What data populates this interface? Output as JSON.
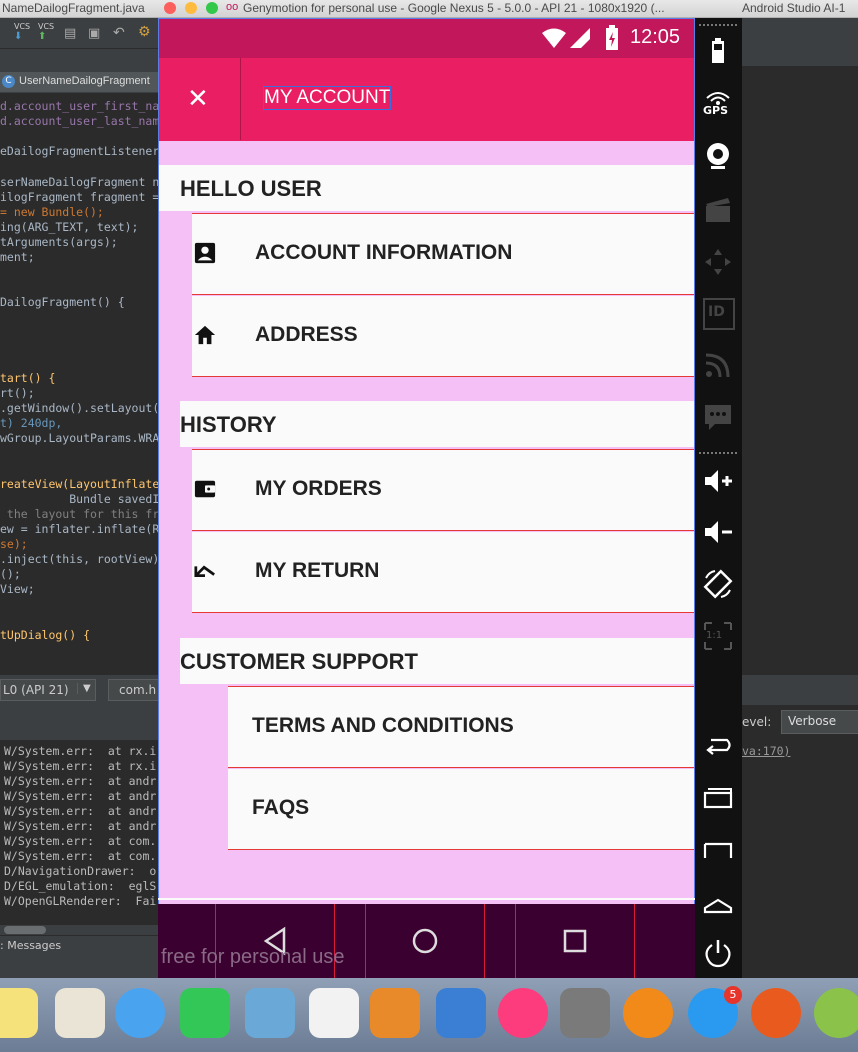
{
  "window": {
    "left_title": "NameDailogFragment.java",
    "title": "Genymotion for personal use - Google Nexus 5 - 5.0.0 - API 21 - 1080x1920 (...",
    "right_title": "Android Studio AI-1",
    "traffic_colors": [
      "#fc605c",
      "#fdbc40",
      "#34c84a"
    ]
  },
  "ide": {
    "vcs_labels": [
      "VCS",
      "VCS"
    ],
    "tab": "UserNameDailogFragment",
    "code_lines": [
      {
        "text": "d.account_user_first_na",
        "color": "#9876aa"
      },
      {
        "text": "d.account_user_last_nam",
        "color": "#9876aa"
      },
      {
        "text": "",
        "color": "#a9b7c6"
      },
      {
        "text": "eDailogFragmentListener",
        "color": "#a9b7c6"
      },
      {
        "text": "",
        "color": "#a9b7c6"
      },
      {
        "text": "serNameDailogFragment n",
        "color": "#a9b7c6"
      },
      {
        "text": "ilogFragment fragment =",
        "color": "#a9b7c6"
      },
      {
        "text": "= new Bundle();",
        "color": "#cc7832"
      },
      {
        "text": "ing(ARG_TEXT, text);",
        "color": "#a9b7c6"
      },
      {
        "text": "tArguments(args);",
        "color": "#a9b7c6"
      },
      {
        "text": "ment;",
        "color": "#a9b7c6"
      },
      {
        "text": "",
        "color": "#a9b7c6"
      },
      {
        "text": "",
        "color": "#a9b7c6"
      },
      {
        "text": "DailogFragment() {",
        "color": "#a9b7c6"
      },
      {
        "text": "",
        "color": "#a9b7c6"
      },
      {
        "text": "",
        "color": "#a9b7c6"
      },
      {
        "text": "",
        "color": "#a9b7c6"
      },
      {
        "text": "",
        "color": "#a9b7c6"
      },
      {
        "text": "tart() {",
        "color": "#ffc66d"
      },
      {
        "text": "rt();",
        "color": "#a9b7c6"
      },
      {
        "text": ".getWindow().setLayout(",
        "color": "#a9b7c6"
      },
      {
        "text": "t) 240dp,",
        "color": "#6897bb"
      },
      {
        "text": "wGroup.LayoutParams.WRA",
        "color": "#a9b7c6"
      },
      {
        "text": "",
        "color": "#a9b7c6"
      },
      {
        "text": "",
        "color": "#a9b7c6"
      },
      {
        "text": "reateView(LayoutInflate",
        "color": "#ffc66d"
      },
      {
        "text": "          Bundle savedI",
        "color": "#a9b7c6"
      },
      {
        "text": " the layout for this fra",
        "color": "#808080"
      },
      {
        "text": "ew = inflater.inflate(R",
        "color": "#a9b7c6"
      },
      {
        "text": "se);",
        "color": "#cc7832"
      },
      {
        "text": ".inject(this, rootView)",
        "color": "#a9b7c6"
      },
      {
        "text": "();",
        "color": "#a9b7c6"
      },
      {
        "text": "View;",
        "color": "#a9b7c6"
      },
      {
        "text": "",
        "color": "#a9b7c6"
      },
      {
        "text": "",
        "color": "#a9b7c6"
      },
      {
        "text": "tUpDialog() {",
        "color": "#ffc66d"
      }
    ],
    "device_select": "L0 (API 21)",
    "package_select": "com.h",
    "log_level_label": "evel:",
    "log_level_value": "Verbose",
    "log_right_fragment": "va:170)",
    "log_lines": [
      "W/System.err:  at rx.i",
      "W/System.err:  at rx.i",
      "W/System.err:  at andr",
      "W/System.err:  at andr",
      "W/System.err:  at andr",
      "W/System.err:  at andr",
      "W/System.err:  at com.",
      "W/System.err:  at com.",
      "D/NavigationDrawer:  o",
      "D/EGL_emulation:  eglS",
      "W/OpenGLRenderer:  Fai"
    ],
    "messages_tab": ": Messages"
  },
  "phone": {
    "clock": "12:05",
    "appbar_title": "MY ACCOUNT",
    "close_icon": "close-icon",
    "sections": [
      {
        "title": "HELLO USER",
        "items": [
          {
            "label": "ACCOUNT INFORMATION",
            "icon": "account-box-icon"
          },
          {
            "label": "ADDRESS",
            "icon": "home-icon"
          }
        ]
      },
      {
        "title": "HISTORY",
        "items": [
          {
            "label": "MY ORDERS",
            "icon": "wallet-icon"
          },
          {
            "label": "MY RETURN",
            "icon": "return-arrow-icon"
          }
        ]
      },
      {
        "title": "CUSTOMER SUPPORT",
        "items": [
          {
            "label": "TERMS AND CONDITIONS",
            "icon": ""
          },
          {
            "label": "FAQS",
            "icon": ""
          }
        ]
      }
    ],
    "watermark": "free for personal use",
    "colors": {
      "primary": "#e91e63",
      "primary_dark": "#c2185b",
      "background": "#f5c0f5",
      "divider": "#e53935"
    }
  },
  "side_panel": {
    "gps_label": "GPS",
    "id_label": "ID",
    "scale_label": "1:1"
  },
  "dock": {
    "badge": "5"
  }
}
